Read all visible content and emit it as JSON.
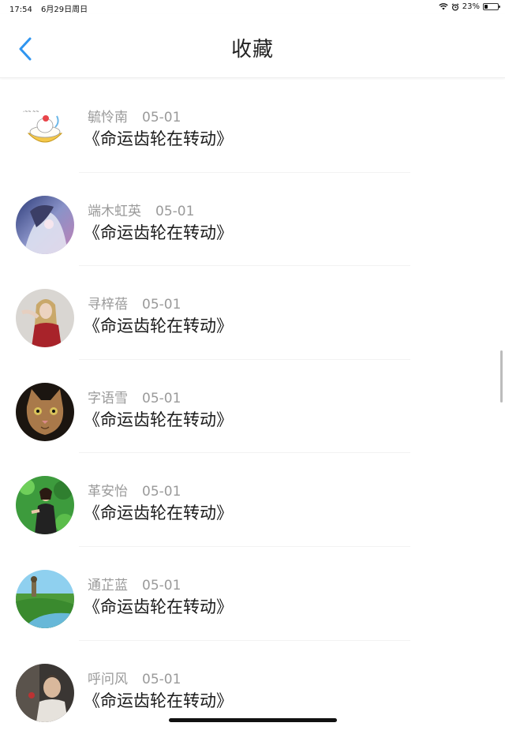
{
  "status": {
    "time": "17:54",
    "date": "6月29日周日",
    "battery": "23%",
    "battery_level": 0.23
  },
  "navbar": {
    "title": "收藏"
  },
  "items": [
    {
      "name": "毓怜南",
      "date": "05-01",
      "title": "《命运齿轮在转动》",
      "avatar": "cartoon-bowl"
    },
    {
      "name": "端木虹英",
      "date": "05-01",
      "title": "《命运齿轮在转动》",
      "avatar": "anime-girl"
    },
    {
      "name": "寻梓蓓",
      "date": "05-01",
      "title": "《命运齿轮在转动》",
      "avatar": "woman-red-top"
    },
    {
      "name": "字语雪",
      "date": "05-01",
      "title": "《命运齿轮在转动》",
      "avatar": "kitten"
    },
    {
      "name": "革安怡",
      "date": "05-01",
      "title": "《命运齿轮在转动》",
      "avatar": "girl-green"
    },
    {
      "name": "通芷蓝",
      "date": "05-01",
      "title": "《命运齿轮在转动》",
      "avatar": "landscape"
    },
    {
      "name": "呼问风",
      "date": "05-01",
      "title": "《命运齿轮在转动》",
      "avatar": "man-portrait"
    }
  ]
}
